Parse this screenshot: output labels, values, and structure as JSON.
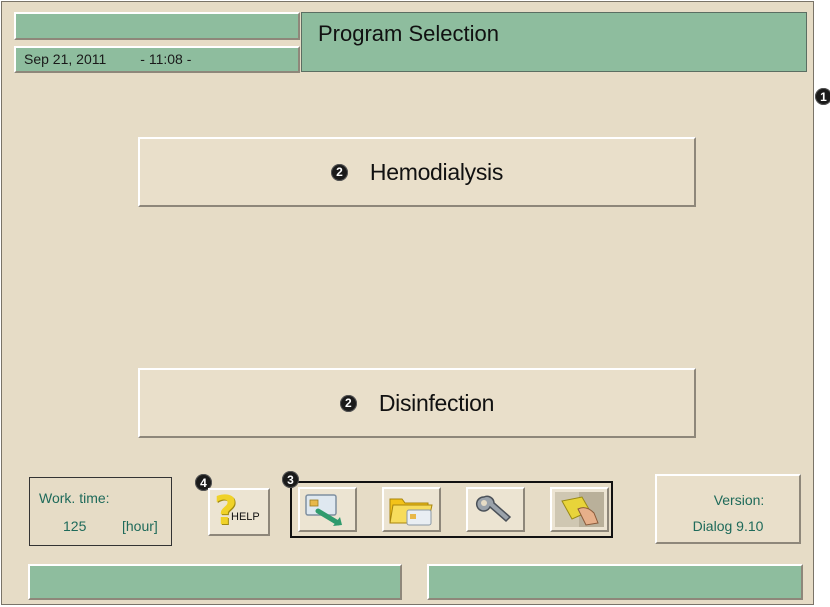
{
  "header": {
    "date": "Sep 21, 2011",
    "time": "- 11:08 -",
    "title": "Program Selection"
  },
  "programs": [
    {
      "marker": "2",
      "label": "Hemodialysis"
    },
    {
      "marker": "2",
      "label": "Disinfection"
    }
  ],
  "work_time": {
    "label": "Work. time:",
    "value": "125",
    "unit": "[hour]"
  },
  "help": {
    "marker": "4",
    "label": "HELP"
  },
  "toolbar": {
    "marker": "3",
    "buttons": [
      {
        "icon": "card-insert-icon"
      },
      {
        "icon": "folder-card-icon"
      },
      {
        "icon": "wrench-icon"
      },
      {
        "icon": "cleaning-hand-icon"
      }
    ]
  },
  "version": {
    "label": "Version:",
    "value": "Dialog  9.10"
  },
  "side_marker": "1",
  "colors": {
    "background": "#e6dcc6",
    "panel_green": "#8ebd9e",
    "text_teal": "#1e6a5a",
    "help_yellow": "#f0d228"
  }
}
